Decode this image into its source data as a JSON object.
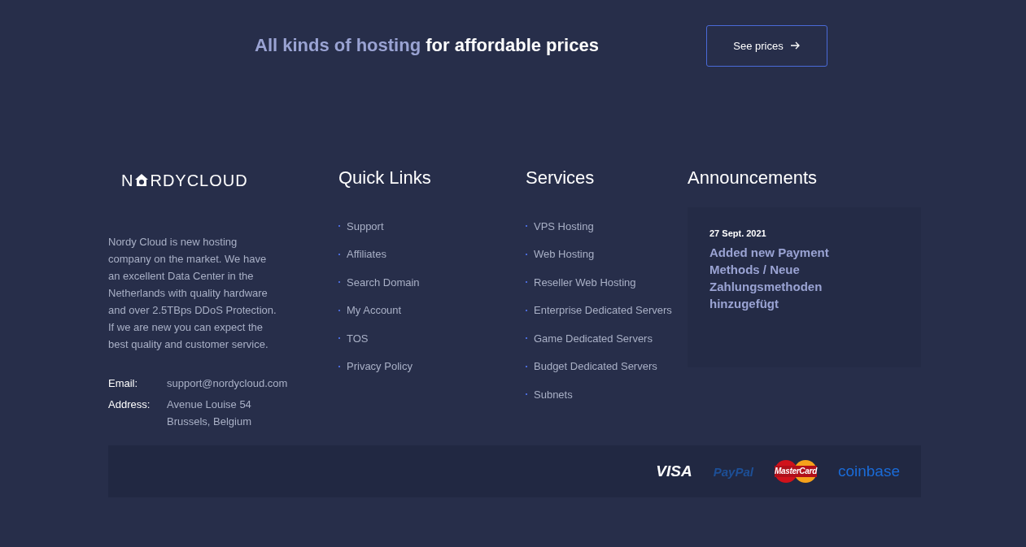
{
  "banner": {
    "highlight": "All kinds of hosting",
    "rest": "for affordable prices",
    "button": "See prices"
  },
  "logo": {
    "before": "N",
    "after": "RDYCLOUD"
  },
  "about": {
    "text": "Nordy Cloud is new hosting company on the market. We have an excellent Data Center in the Netherlands with quality hardware and over 2.5TBps DDoS Protection. If we are new you can expect the best quality and customer service.",
    "contacts": [
      {
        "label": "Email:",
        "lines": [
          "support@nordycloud.com"
        ]
      },
      {
        "label": "Address:",
        "lines": [
          "Avenue Louise 54",
          "Brussels, Belgium"
        ]
      }
    ]
  },
  "quick_links": {
    "title": "Quick Links",
    "items": [
      "Support",
      "Affiliates",
      "Search Domain",
      "My Account",
      "TOS",
      "Privacy Policy"
    ]
  },
  "services": {
    "title": "Services",
    "items": [
      "VPS Hosting",
      "Web Hosting",
      "Reseller Web Hosting",
      "Enterprise Dedicated Servers",
      "Game Dedicated Servers",
      "Budget Dedicated Servers",
      "Subnets"
    ]
  },
  "announcements": {
    "title": "Announcements",
    "items": [
      {
        "date": "27 Sept. 2021",
        "text": "Added new Payment Methods / Neue Zahlungsmethoden hinzugefügt"
      }
    ]
  },
  "payments": [
    {
      "kind": "visa",
      "text": "VISA"
    },
    {
      "kind": "paypal",
      "text": "PayPal"
    },
    {
      "kind": "mastercard",
      "text": "MasterCard"
    },
    {
      "kind": "coinbase",
      "text": "coinbase"
    }
  ]
}
